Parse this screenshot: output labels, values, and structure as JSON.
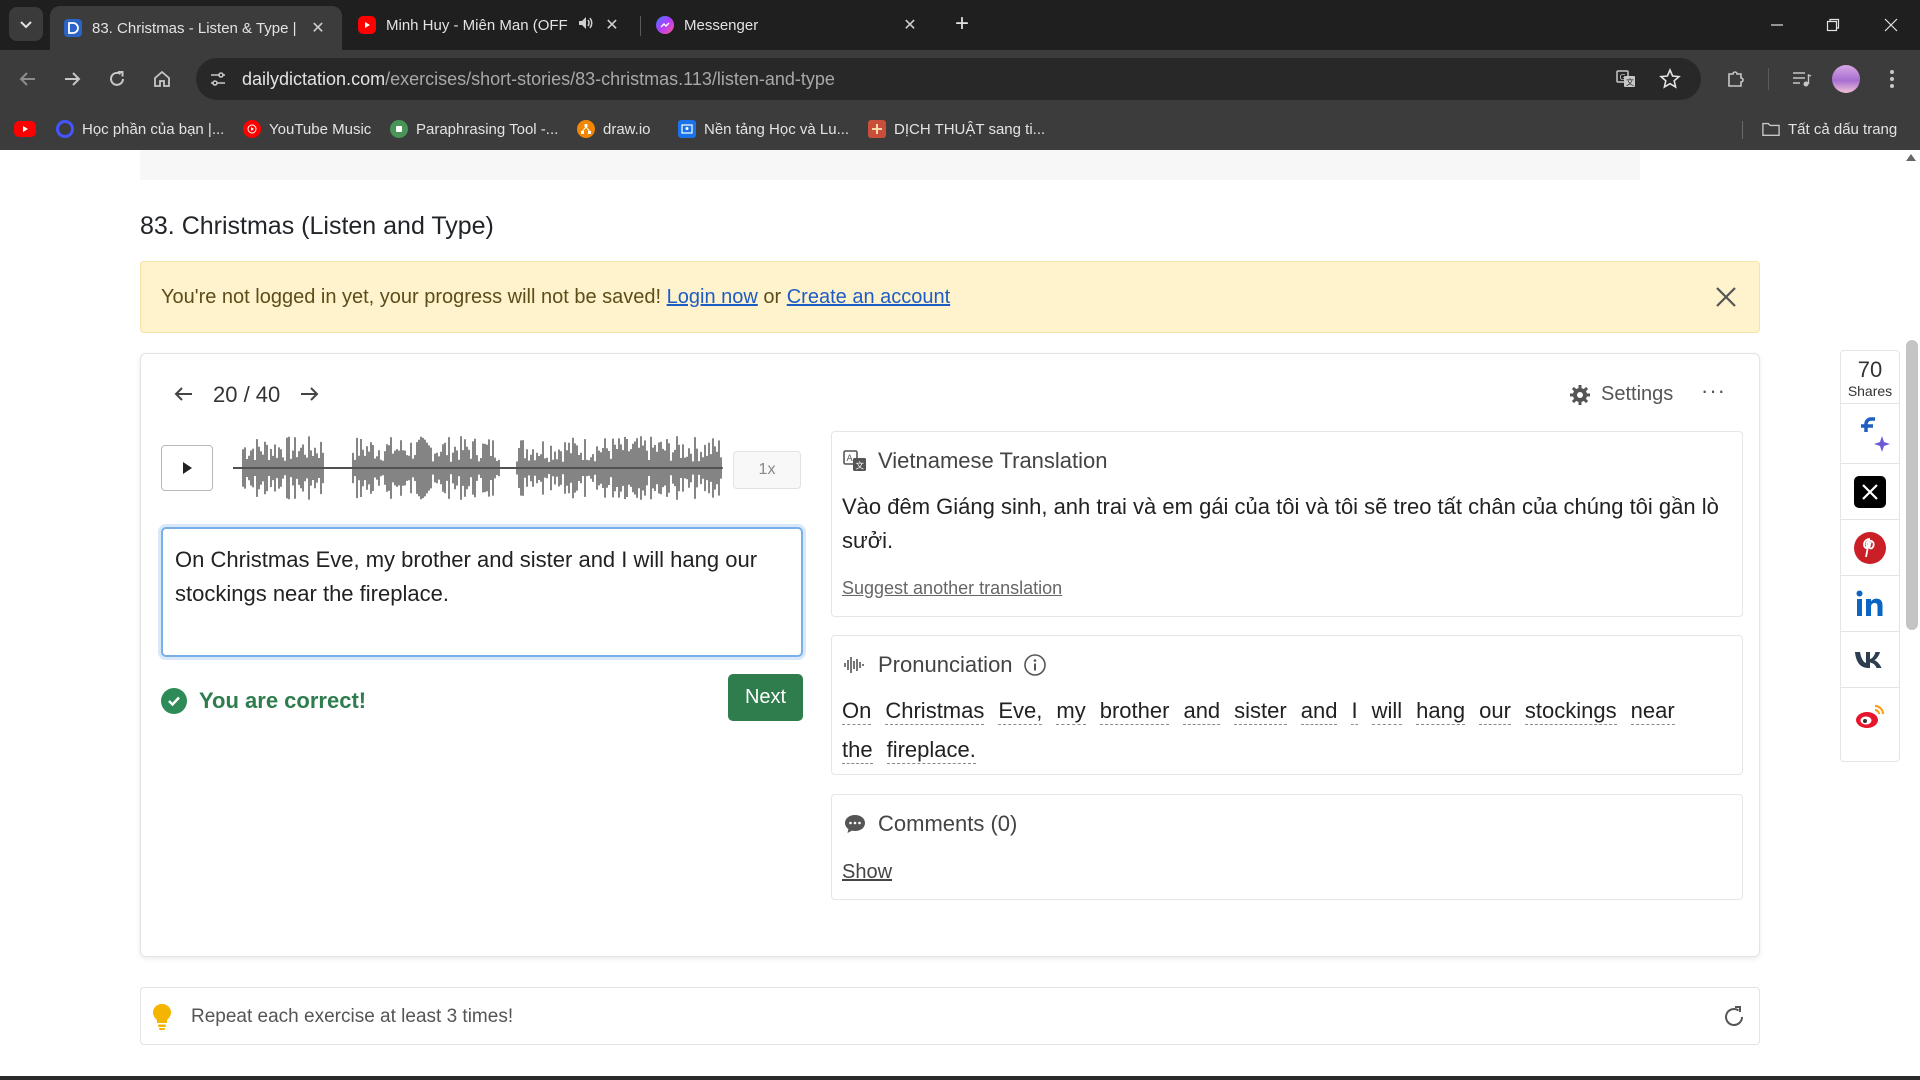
{
  "browser": {
    "tabs": [
      {
        "title": "83. Christmas - Listen & Type | D",
        "active": true
      },
      {
        "title": "Minh Huy - Miên Man (OFF",
        "active": false
      },
      {
        "title": "Messenger",
        "active": false
      }
    ],
    "url_host": "dailydictation.com",
    "url_path": "/exercises/short-stories/83-christmas.113/listen-and-type",
    "bookmarks": [
      {
        "label": ""
      },
      {
        "label": "Học phần của bạn |..."
      },
      {
        "label": "YouTube Music"
      },
      {
        "label": "Paraphrasing Tool -..."
      },
      {
        "label": "draw.io"
      },
      {
        "label": "Nền tảng Học và Lu..."
      },
      {
        "label": "DỊCH THUẬT sang ti..."
      }
    ],
    "all_bookmarks": "Tất cả dấu trang"
  },
  "page": {
    "title": "83. Christmas (Listen and Type)",
    "alert": {
      "text": "You're not logged in yet, your progress will not be saved!",
      "login": "Login now",
      "or": "or",
      "create": "Create an account"
    },
    "exercise": {
      "current": "20 / 40",
      "settings": "Settings",
      "more": "···",
      "speed": "1x",
      "answer": "On Christmas Eve, my brother and sister and I will hang our stockings near the fireplace.",
      "result": "You are correct!",
      "next": "Next"
    },
    "translation": {
      "heading": "Vietnamese Translation",
      "text": "Vào đêm Giáng sinh, anh trai và em gái của tôi và tôi sẽ treo tất chân của chúng tôi gần lò sưởi.",
      "suggest": "Suggest another translation"
    },
    "pronunciation": {
      "heading": "Pronunciation",
      "words": [
        "On",
        "Christmas",
        "Eve,",
        "my",
        "brother",
        "and",
        "sister",
        "and",
        "I",
        "will",
        "hang",
        "our",
        "stockings",
        "near",
        "the",
        "fireplace."
      ]
    },
    "comments": {
      "heading": "Comments (0)",
      "show": "Show"
    },
    "tip": "Repeat each exercise at least 3 times!",
    "share": {
      "count": "70",
      "label": "Shares"
    }
  },
  "colors": {
    "correct_green": "#2e7d4f",
    "next_button": "#2f7d4d",
    "alert_bg": "#fff3cd",
    "link_blue": "#1d5cc4"
  }
}
